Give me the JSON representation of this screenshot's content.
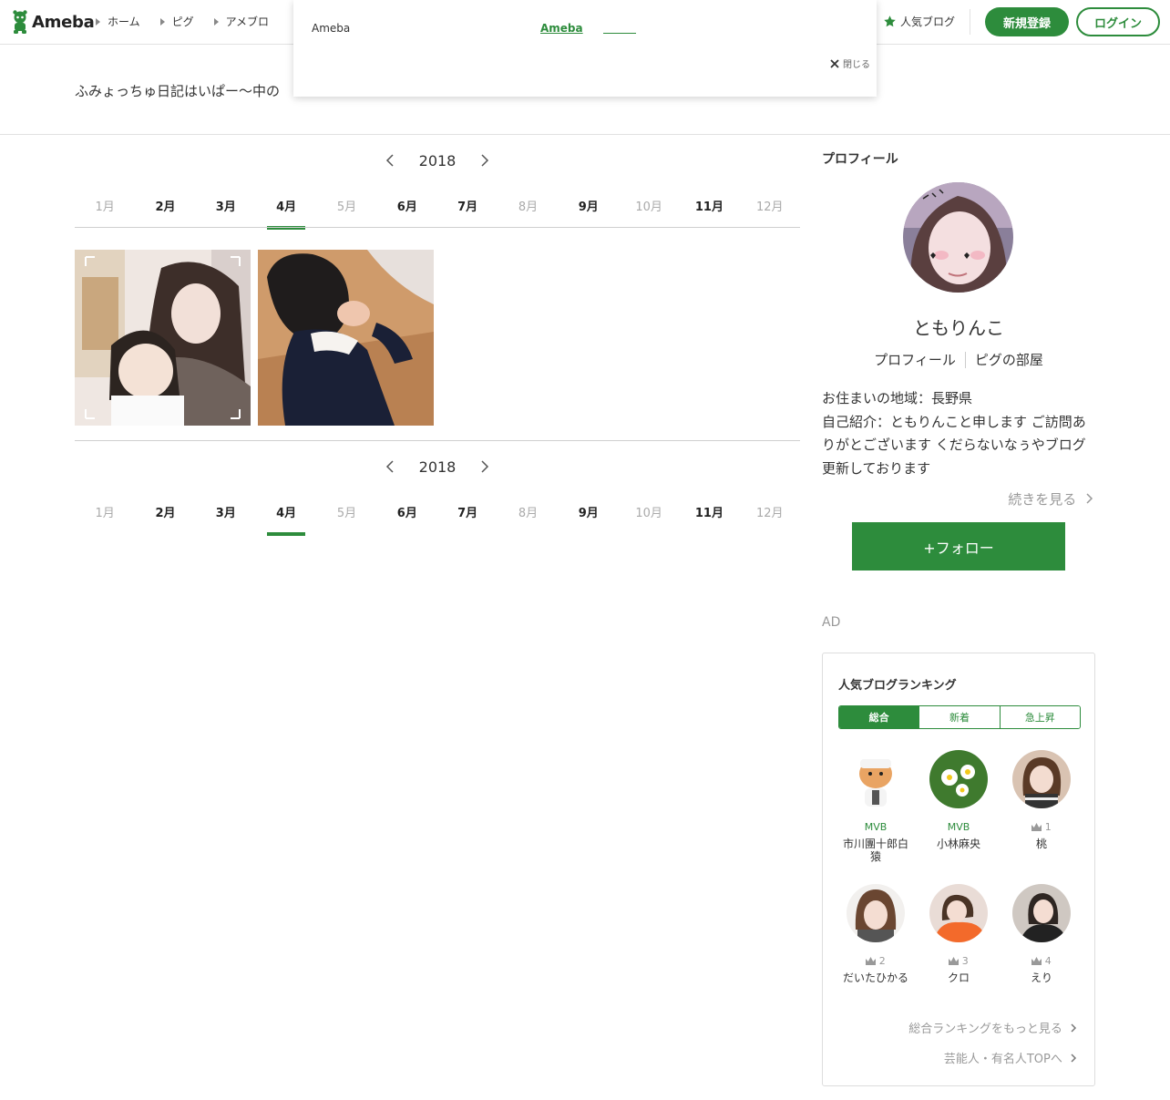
{
  "header": {
    "logo_text": "Ameba",
    "nav": [
      "ホーム",
      "ピグ",
      "アメブロ"
    ],
    "popular_label": "人気ブログ",
    "signup_label": "新規登録",
    "login_label": "ログイン"
  },
  "popup": {
    "brand": "Ameba",
    "link_text": "Ameba",
    "close_label": "閉じる"
  },
  "blog": {
    "title": "ふみょっちゅ日記はいぱー〜中の"
  },
  "calendar": {
    "year": "2018",
    "months": [
      {
        "label": "1月",
        "active": false
      },
      {
        "label": "2月",
        "active": true
      },
      {
        "label": "3月",
        "active": true
      },
      {
        "label": "4月",
        "active": true,
        "selected": true
      },
      {
        "label": "5月",
        "active": false
      },
      {
        "label": "6月",
        "active": true
      },
      {
        "label": "7月",
        "active": true
      },
      {
        "label": "8月",
        "active": false
      },
      {
        "label": "9月",
        "active": true
      },
      {
        "label": "10月",
        "active": false
      },
      {
        "label": "11月",
        "active": true
      },
      {
        "label": "12月",
        "active": false
      }
    ]
  },
  "profile": {
    "heading": "プロフィール",
    "nickname": "ともりんこ",
    "link_profile": "プロフィール",
    "link_room": "ピグの部屋",
    "bio_line1": "お住まいの地域：長野県",
    "bio_line2": "自己紹介：ともりんこと申します ご訪問ありがとございます くだらないなぅやブログ更新しております",
    "more_label": "続きを見る",
    "follow_label": "+フォロー"
  },
  "ad_label": "AD",
  "ranking": {
    "heading": "人気ブログランキング",
    "tabs": [
      "総合",
      "新着",
      "急上昇"
    ],
    "items": [
      {
        "badge": "MVB",
        "name": "市川團十郎白猿"
      },
      {
        "badge": "MVB",
        "name": "小林麻央"
      },
      {
        "badge": "1",
        "name": "桃"
      },
      {
        "badge": "2",
        "name": "だいたひかる"
      },
      {
        "badge": "3",
        "name": "クロ"
      },
      {
        "badge": "4",
        "name": "えり"
      }
    ],
    "more_overall": "総合ランキングをもっと見る",
    "more_celeb": "芸能人・有名人TOPへ"
  }
}
